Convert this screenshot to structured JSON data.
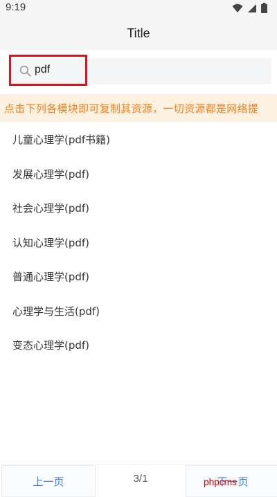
{
  "status_bar": {
    "time": "9:19",
    "icons": [
      "wifi-icon",
      "cellular-signal-icon",
      "battery-icon"
    ]
  },
  "header": {
    "title": "Title"
  },
  "search": {
    "value": "pdf",
    "icon": "search-icon"
  },
  "notice": {
    "text": "点击下列各模块即可复制其资源，一切资源都是网络提"
  },
  "list": {
    "items": [
      {
        "label": "儿童心理学(pdf书籍)"
      },
      {
        "label": "发展心理学(pdf)"
      },
      {
        "label": "社会心理学(pdf)"
      },
      {
        "label": "认知心理学(pdf)"
      },
      {
        "label": "普通心理学(pdf)"
      },
      {
        "label": "心理学与生活(pdf)"
      },
      {
        "label": "变态心理学(pdf)"
      }
    ]
  },
  "pager": {
    "prev_label": "上一页",
    "page_indicator": "3/1",
    "next_label": "下一页"
  },
  "watermark": {
    "text": "phpcms"
  },
  "colors": {
    "highlight": "#d4151e",
    "notice_text": "#f0801d",
    "notice_bg": "#fdf1e1",
    "pager_link": "#3a7bd5",
    "watermark": "#d40000"
  }
}
